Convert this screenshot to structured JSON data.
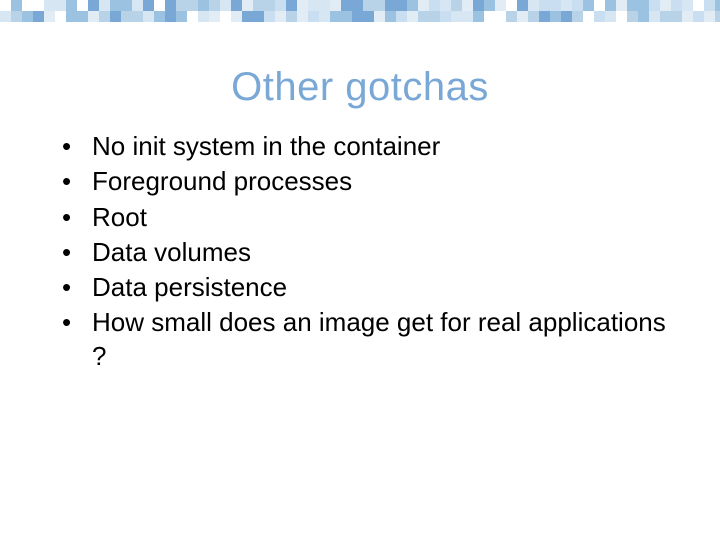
{
  "title": "Other gotchas",
  "bullets": {
    "b0": "No init system in the container",
    "b1": "Foreground processes",
    "b2": "Root",
    "b3": "Data volumes",
    "b4": "Data persistence",
    "b5": "How small does an image get for real applications ?"
  },
  "mosaic_palette": [
    "#7aa8d6",
    "#c9def0",
    "#e2ecf5",
    "#9bc2e0",
    "#b8d3e8",
    "#d6e6f3"
  ]
}
